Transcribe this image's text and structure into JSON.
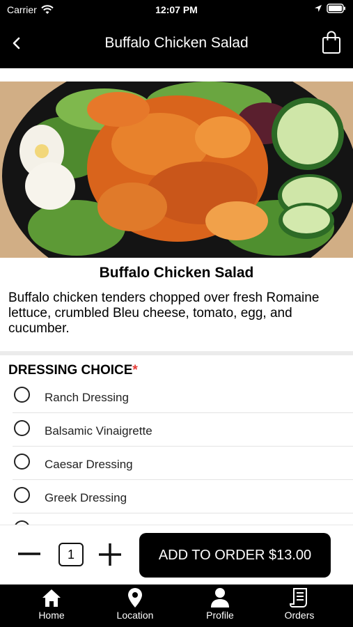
{
  "status_bar": {
    "carrier": "Carrier",
    "time": "12:07 PM"
  },
  "nav": {
    "title": "Buffalo Chicken Salad",
    "back_icon": "chevron-left-icon",
    "cart_icon": "shopping-bag-icon"
  },
  "item": {
    "name": "Buffalo Chicken Salad",
    "description": "Buffalo chicken tenders chopped over fresh Romaine lettuce, crumbled Bleu cheese, tomato, egg, and cucumber."
  },
  "dressing": {
    "title": "DRESSING CHOICE",
    "required_mark": "*",
    "options": [
      {
        "label": "Ranch Dressing",
        "selected": false
      },
      {
        "label": "Balsamic Vinaigrette",
        "selected": false
      },
      {
        "label": "Caesar Dressing",
        "selected": false
      },
      {
        "label": "Greek Dressing",
        "selected": false
      }
    ]
  },
  "order": {
    "quantity": "1",
    "add_label": "ADD TO ORDER $13.00"
  },
  "tabs": [
    {
      "label": "Home",
      "icon": "home-icon"
    },
    {
      "label": "Location",
      "icon": "location-pin-icon"
    },
    {
      "label": "Profile",
      "icon": "profile-icon"
    },
    {
      "label": "Orders",
      "icon": "orders-icon"
    }
  ],
  "colors": {
    "bar_background": "#000000",
    "required": "#e53935",
    "button": "#000000"
  }
}
